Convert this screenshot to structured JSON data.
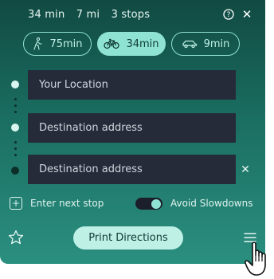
{
  "summary": {
    "duration": "34 min",
    "distance": "7 mi",
    "stops": "3 stops"
  },
  "modes": [
    {
      "label": "75min",
      "icon": "walk-icon"
    },
    {
      "label": "34min",
      "icon": "bike-icon",
      "active": true
    },
    {
      "label": "9min",
      "icon": "car-icon"
    }
  ],
  "fields": {
    "origin": "Your Location",
    "destination1": "Destination address",
    "destination2": "Destination address"
  },
  "actions": {
    "add_stop": "Enter next stop",
    "avoid_slowdowns": "Avoid Slowdowns",
    "avoid_slowdowns_on": true,
    "print": "Print Directions"
  },
  "colors": {
    "accent": "#8fe3d3",
    "panel_top": "#114a42",
    "panel_bottom": "#2b8f80",
    "field_bg": "#262b3a"
  }
}
